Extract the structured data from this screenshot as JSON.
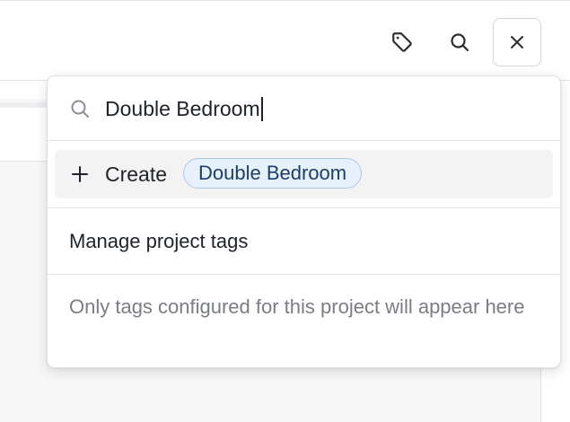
{
  "toolbar": {
    "tag_button_icon": "tag-icon",
    "search_button_icon": "search-icon",
    "close_button_icon": "close-icon"
  },
  "tag_picker": {
    "search": {
      "value": "Double Bedroom",
      "icon": "search-icon"
    },
    "create_option": {
      "icon": "plus-icon",
      "label": "Create",
      "tag_name": "Double Bedroom"
    },
    "manage_label": "Manage project tags",
    "hint": "Only tags configured for this project will appear here"
  },
  "colors": {
    "chip_background": "#e6f1fb",
    "chip_border": "#a9c8ea",
    "chip_text": "#1d3f66",
    "hint_text": "#7a7d82",
    "create_row_background": "#f3f3f4"
  }
}
